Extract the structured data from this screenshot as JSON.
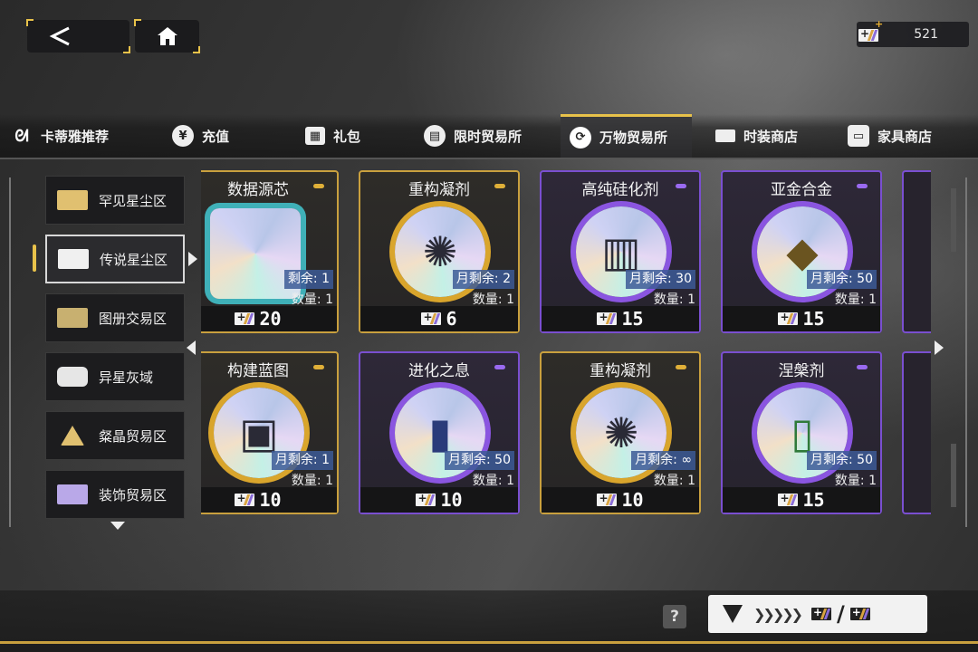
{
  "currency": {
    "amount": "521"
  },
  "tabs": [
    {
      "label": "卡蒂雅推荐",
      "icon": "rabbit-icon"
    },
    {
      "label": "充值",
      "icon": "yen-icon"
    },
    {
      "label": "礼包",
      "icon": "gift-icon"
    },
    {
      "label": "限时贸易所",
      "icon": "clock-shop-icon"
    },
    {
      "label": "万物贸易所",
      "icon": "exchange-icon"
    },
    {
      "label": "时装商店",
      "icon": "card-icon"
    },
    {
      "label": "家具商店",
      "icon": "sofa-icon"
    }
  ],
  "active_tab": "万物贸易所",
  "side_menu": [
    {
      "label": "罕见星尘区"
    },
    {
      "label": "传说星尘区"
    },
    {
      "label": "图册交易区"
    },
    {
      "label": "异星灰域"
    },
    {
      "label": "粲晶贸易区"
    },
    {
      "label": "装饰贸易区"
    }
  ],
  "active_side": "传说星尘区",
  "items": [
    {
      "name": "数据源芯",
      "remain": "剩余: 1",
      "qty": "数量: 1",
      "price": "20",
      "rarity": "gold",
      "icon": "frame-core-icon"
    },
    {
      "name": "重构凝剂",
      "remain": "月剩余: 2",
      "qty": "数量: 1",
      "price": "6",
      "rarity": "gold",
      "icon": "fan-block-icon"
    },
    {
      "name": "高纯硅化剂",
      "remain": "月剩余: 30",
      "qty": "数量: 1",
      "price": "15",
      "rarity": "purple",
      "icon": "canister-icon"
    },
    {
      "name": "亚金合金",
      "remain": "月剩余: 50",
      "qty": "数量: 1",
      "price": "15",
      "rarity": "purple",
      "icon": "ore-cube-icon"
    },
    {
      "name": "构建蓝图",
      "remain": "月剩余: 1",
      "qty": "数量: 1",
      "price": "10",
      "rarity": "gold",
      "icon": "blueprint-icon"
    },
    {
      "name": "进化之息",
      "remain": "月剩余: 50",
      "qty": "数量: 1",
      "price": "10",
      "rarity": "purple",
      "icon": "spray-can-icon"
    },
    {
      "name": "重构凝剂",
      "remain": "月剩余: ∞",
      "qty": "数量: 1",
      "price": "10",
      "rarity": "gold",
      "icon": "fan-block-icon"
    },
    {
      "name": "涅槃剂",
      "remain": "月剩余: 50",
      "qty": "数量: 1",
      "price": "15",
      "rarity": "purple",
      "icon": "vial-icon"
    }
  ],
  "help": {
    "label": "?"
  },
  "colors": {
    "gold": "#c9a03e",
    "purple": "#7a4fd0",
    "accent": "#e8c24a"
  }
}
